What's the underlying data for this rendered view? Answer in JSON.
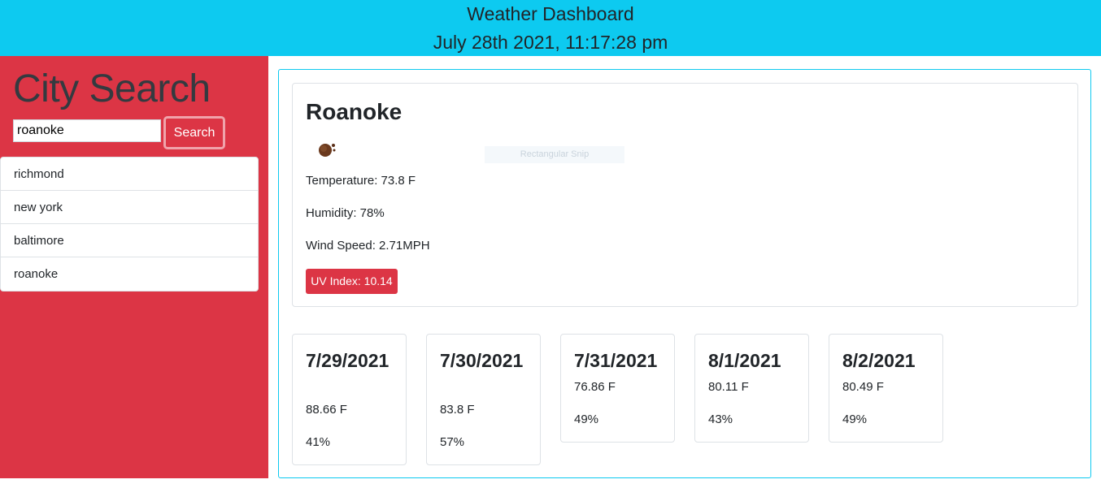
{
  "header": {
    "title": "Weather Dashboard",
    "datetime": "July 28th 2021, 11:17:28 pm"
  },
  "sidebar": {
    "heading": "City Search",
    "search_value": "roanoke",
    "search_button_label": "Search",
    "history": [
      {
        "label": "richmond"
      },
      {
        "label": "new york"
      },
      {
        "label": "baltimore"
      },
      {
        "label": "roanoke"
      }
    ]
  },
  "current": {
    "city": "Roanoke",
    "weather_icon": "weather-icon",
    "snip_tag": "Rectangular Snip",
    "temperature": "Temperature: 73.8 F",
    "humidity": "Humidity: 78%",
    "wind": "Wind Speed: 2.71MPH",
    "uv": "UV Index: 10.14"
  },
  "forecast": [
    {
      "date": "7/29/2021",
      "temp": "88.66 F",
      "humidity": "41%"
    },
    {
      "date": "7/30/2021",
      "temp": "83.8 F",
      "humidity": "57%"
    },
    {
      "date": "7/31/2021",
      "temp": "76.86 F",
      "humidity": "49%"
    },
    {
      "date": "8/1/2021",
      "temp": "80.11 F",
      "humidity": "43%"
    },
    {
      "date": "8/2/2021",
      "temp": "80.49 F",
      "humidity": "49%"
    }
  ],
  "colors": {
    "header": "#0dcaf0",
    "sidebar": "#dc3545",
    "uv_badge": "#dc3545"
  }
}
